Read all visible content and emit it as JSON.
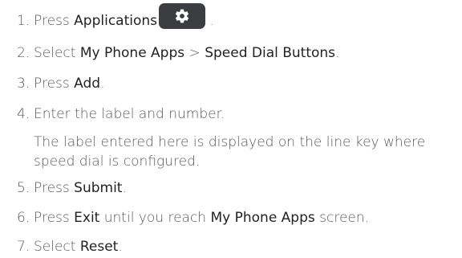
{
  "steps": [
    {
      "num": "1.",
      "t1": "Press ",
      "b1": "Applications",
      "t2": " ."
    },
    {
      "num": "2.",
      "t1": "Select ",
      "b1": "My Phone Apps",
      "t2": " > ",
      "b2": "Speed Dial Buttons",
      "t3": "."
    },
    {
      "num": "3.",
      "t1": "Press ",
      "b1": "Add",
      "t2": "."
    },
    {
      "num": "4.",
      "t1": "Enter the label and number."
    },
    {
      "num": "5.",
      "t1": "Press ",
      "b1": "Submit",
      "t2": "."
    },
    {
      "num": "6.",
      "t1": "Press ",
      "b1": "Exit",
      "t2": " until you reach ",
      "b2": "My Phone Apps",
      "t3": " screen."
    },
    {
      "num": "7.",
      "t1": "Select ",
      "b1": "Reset",
      "t2": "."
    }
  ],
  "note": "The label entered here is displayed on the line key where speed dial is configured.",
  "icons": {
    "applications": "gear-icon"
  },
  "colors": {
    "text": "#58595b",
    "bold": "#231f20",
    "button": "#3c3d40"
  }
}
